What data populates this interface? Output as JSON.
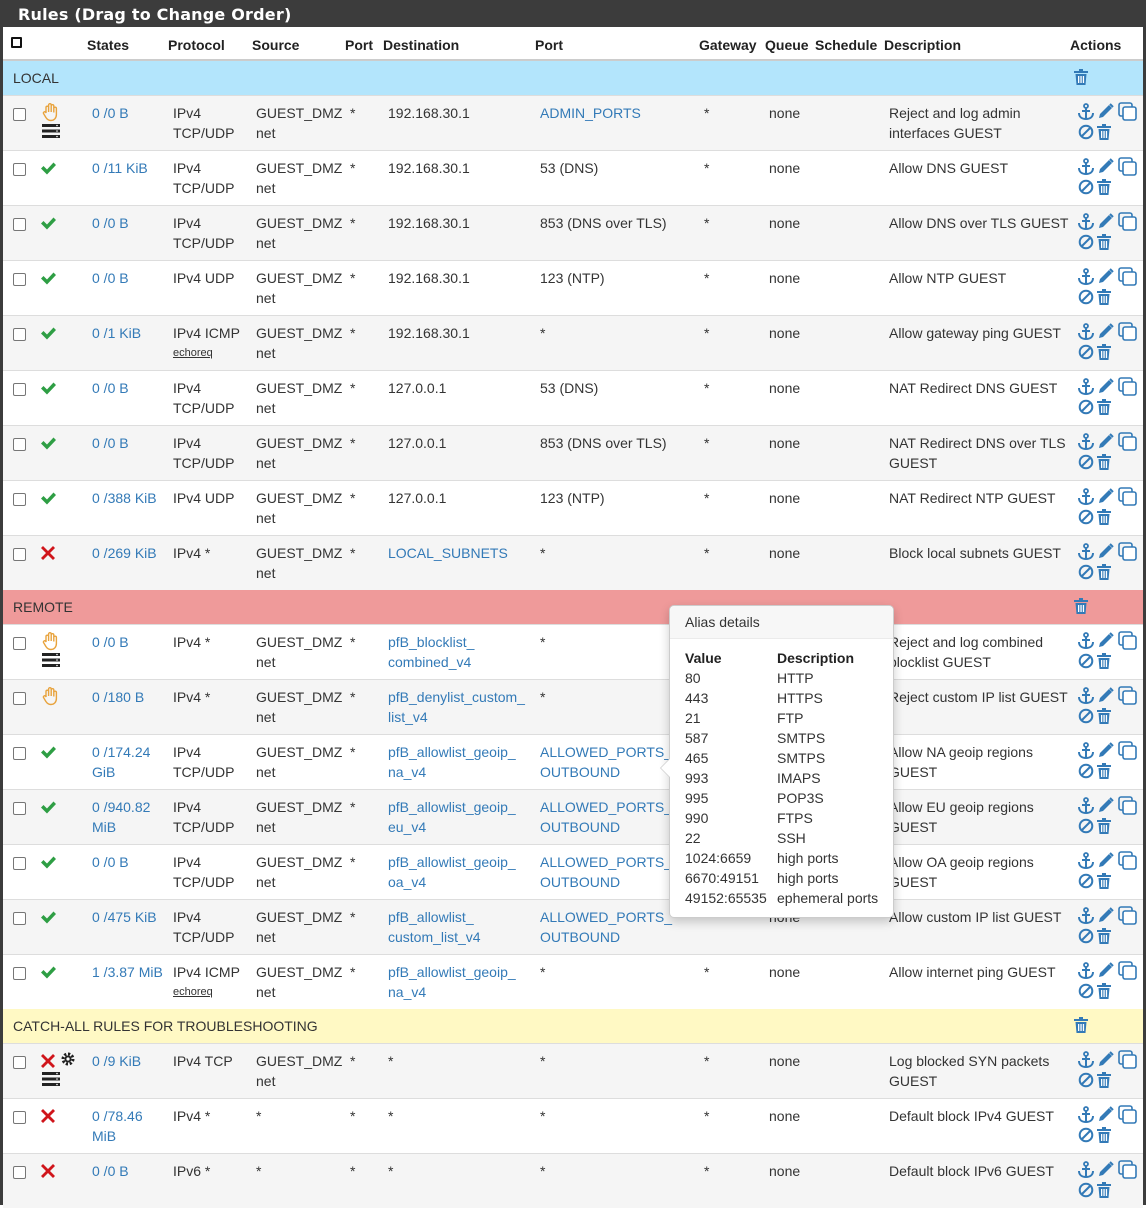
{
  "panel_title": "Rules (Drag to Change Order)",
  "columns": {
    "states": "States",
    "protocol": "Protocol",
    "source": "Source",
    "port": "Port",
    "destination": "Destination",
    "dport": "Port",
    "gateway": "Gateway",
    "queue": "Queue",
    "schedule": "Schedule",
    "description": "Description",
    "actions": "Actions"
  },
  "separators": [
    {
      "label": "LOCAL",
      "color": "#b3e5fc"
    },
    {
      "label": "REMOTE",
      "color": "#ef9a9a"
    },
    {
      "label": "CATCH-ALL RULES FOR TROUBLESHOOTING",
      "color": "#fff9c4"
    }
  ],
  "rules": [
    {
      "status": "reject",
      "log": true,
      "states": "0 /0 B",
      "proto": "IPv4 TCP/UDP",
      "proto2": "",
      "src": "GUEST_DMZ net",
      "sport": "*",
      "dst": "192.168.30.1",
      "dst_link": false,
      "dport": "ADMIN_PORTS",
      "dport_link": true,
      "gw": "*",
      "queue": "none",
      "desc": "Reject and log admin interfaces GUEST"
    },
    {
      "status": "pass",
      "log": false,
      "states": "0 /11 KiB",
      "proto": "IPv4 TCP/UDP",
      "proto2": "",
      "src": "GUEST_DMZ net",
      "sport": "*",
      "dst": "192.168.30.1",
      "dst_link": false,
      "dport": "53 (DNS)",
      "dport_link": false,
      "gw": "*",
      "queue": "none",
      "desc": "Allow DNS GUEST"
    },
    {
      "status": "pass",
      "log": false,
      "states": "0 /0 B",
      "proto": "IPv4 TCP/UDP",
      "proto2": "",
      "src": "GUEST_DMZ net",
      "sport": "*",
      "dst": "192.168.30.1",
      "dst_link": false,
      "dport": "853 (DNS over TLS)",
      "dport_link": false,
      "gw": "*",
      "queue": "none",
      "desc": "Allow DNS over TLS GUEST"
    },
    {
      "status": "pass",
      "log": false,
      "states": "0 /0 B",
      "proto": "IPv4 UDP",
      "proto2": "",
      "src": "GUEST_DMZ net",
      "sport": "*",
      "dst": "192.168.30.1",
      "dst_link": false,
      "dport": "123 (NTP)",
      "dport_link": false,
      "gw": "*",
      "queue": "none",
      "desc": "Allow NTP GUEST"
    },
    {
      "status": "pass",
      "log": false,
      "states": "0 /1 KiB",
      "proto": "IPv4 ICMP",
      "proto2": "echoreq",
      "src": "GUEST_DMZ net",
      "sport": "*",
      "dst": "192.168.30.1",
      "dst_link": false,
      "dport": "*",
      "dport_link": false,
      "gw": "*",
      "queue": "none",
      "desc": "Allow gateway ping GUEST"
    },
    {
      "status": "pass",
      "log": false,
      "states": "0 /0 B",
      "proto": "IPv4 TCP/UDP",
      "proto2": "",
      "src": "GUEST_DMZ net",
      "sport": "*",
      "dst": "127.0.0.1",
      "dst_link": false,
      "dport": "53 (DNS)",
      "dport_link": false,
      "gw": "*",
      "queue": "none",
      "desc": "NAT Redirect DNS GUEST"
    },
    {
      "status": "pass",
      "log": false,
      "states": "0 /0 B",
      "proto": "IPv4 TCP/UDP",
      "proto2": "",
      "src": "GUEST_DMZ net",
      "sport": "*",
      "dst": "127.0.0.1",
      "dst_link": false,
      "dport": "853 (DNS over TLS)",
      "dport_link": false,
      "gw": "*",
      "queue": "none",
      "desc": "NAT Redirect DNS over TLS GUEST"
    },
    {
      "status": "pass",
      "log": false,
      "states": "0 /388 KiB",
      "proto": "IPv4 UDP",
      "proto2": "",
      "src": "GUEST_DMZ net",
      "sport": "*",
      "dst": "127.0.0.1",
      "dst_link": false,
      "dport": "123 (NTP)",
      "dport_link": false,
      "gw": "*",
      "queue": "none",
      "desc": "NAT Redirect NTP GUEST"
    },
    {
      "status": "block",
      "log": false,
      "states": "0 /269 KiB",
      "proto": "IPv4 *",
      "proto2": "",
      "src": "GUEST_DMZ net",
      "sport": "*",
      "dst": "LOCAL_SUBNETS",
      "dst_link": true,
      "dport": "*",
      "dport_link": false,
      "gw": "*",
      "queue": "none",
      "desc": "Block local subnets GUEST"
    },
    {
      "status": "reject",
      "log": true,
      "states": "0 /0 B",
      "proto": "IPv4 *",
      "proto2": "",
      "src": "GUEST_DMZ net",
      "sport": "*",
      "dst": "pfB_blocklist_ combined_v4",
      "dst_link": true,
      "dport": "*",
      "dport_link": false,
      "gw": "",
      "queue": "",
      "desc": "Reject and log combined blocklist GUEST"
    },
    {
      "status": "reject",
      "log": false,
      "states": "0 /180 B",
      "proto": "IPv4 *",
      "proto2": "",
      "src": "GUEST_DMZ net",
      "sport": "*",
      "dst": "pfB_denylist_custom_ list_v4",
      "dst_link": true,
      "dport": "*",
      "dport_link": false,
      "gw": "",
      "queue": "",
      "desc": "Reject custom IP list GUEST"
    },
    {
      "status": "pass",
      "log": false,
      "states": "0 /174.24 GiB",
      "proto": "IPv4 TCP/UDP",
      "proto2": "",
      "src": "GUEST_DMZ net",
      "sport": "*",
      "dst": "pfB_allowlist_geoip_ na_v4",
      "dst_link": true,
      "dport": "ALLOWED_PORTS_ OUTBOUND",
      "dport_link": true,
      "gw": "",
      "queue": "",
      "desc": "Allow NA geoip regions GUEST"
    },
    {
      "status": "pass",
      "log": false,
      "states": "0 /940.82 MiB",
      "proto": "IPv4 TCP/UDP",
      "proto2": "",
      "src": "GUEST_DMZ net",
      "sport": "*",
      "dst": "pfB_allowlist_geoip_ eu_v4",
      "dst_link": true,
      "dport": "ALLOWED_PORTS_ OUTBOUND",
      "dport_link": true,
      "gw": "",
      "queue": "",
      "desc": "Allow EU geoip regions GUEST"
    },
    {
      "status": "pass",
      "log": false,
      "states": "0 /0 B",
      "proto": "IPv4 TCP/UDP",
      "proto2": "",
      "src": "GUEST_DMZ net",
      "sport": "*",
      "dst": "pfB_allowlist_geoip_ oa_v4",
      "dst_link": true,
      "dport": "ALLOWED_PORTS_ OUTBOUND",
      "dport_link": true,
      "gw": "",
      "queue": "",
      "desc": "Allow OA geoip regions GUEST"
    },
    {
      "status": "pass",
      "log": false,
      "states": "0 /475 KiB",
      "proto": "IPv4 TCP/UDP",
      "proto2": "",
      "src": "GUEST_DMZ net",
      "sport": "*",
      "dst": "pfB_allowlist_ custom_list_v4",
      "dst_link": true,
      "dport": "ALLOWED_PORTS_ OUTBOUND",
      "dport_link": true,
      "gw": "",
      "queue": "none",
      "desc": "Allow custom IP list GUEST"
    },
    {
      "status": "pass",
      "log": false,
      "states": "1 /3.87 MiB",
      "proto": "IPv4 ICMP",
      "proto2": "echoreq",
      "src": "GUEST_DMZ net",
      "sport": "*",
      "dst": "pfB_allowlist_geoip_ na_v4",
      "dst_link": true,
      "dport": "*",
      "dport_link": false,
      "gw": "*",
      "queue": "none",
      "desc": "Allow internet ping GUEST"
    },
    {
      "status": "block",
      "log": true,
      "adv": true,
      "states": "0 /9 KiB",
      "proto": "IPv4 TCP",
      "proto2": "",
      "src": "GUEST_DMZ net",
      "sport": "*",
      "dst": "*",
      "dst_link": false,
      "dport": "*",
      "dport_link": false,
      "gw": "*",
      "queue": "none",
      "desc": "Log blocked SYN packets GUEST"
    },
    {
      "status": "block",
      "log": false,
      "states": "0 /78.46 MiB",
      "proto": "IPv4 *",
      "proto2": "",
      "src": "*",
      "sport": "*",
      "dst": "*",
      "dst_link": false,
      "dport": "*",
      "dport_link": false,
      "gw": "*",
      "queue": "none",
      "desc": "Default block IPv4 GUEST"
    },
    {
      "status": "block",
      "log": false,
      "states": "0 /0 B",
      "proto": "IPv6 *",
      "proto2": "",
      "src": "*",
      "sport": "*",
      "dst": "*",
      "dst_link": false,
      "dport": "*",
      "dport_link": false,
      "gw": "*",
      "queue": "none",
      "desc": "Default block IPv6 GUEST"
    }
  ],
  "popover": {
    "title": "Alias details",
    "col_value": "Value",
    "col_desc": "Description",
    "items": [
      {
        "v": "80",
        "d": "HTTP"
      },
      {
        "v": "443",
        "d": "HTTPS"
      },
      {
        "v": "21",
        "d": "FTP"
      },
      {
        "v": "587",
        "d": "SMTPS"
      },
      {
        "v": "465",
        "d": "SMTPS"
      },
      {
        "v": "993",
        "d": "IMAPS"
      },
      {
        "v": "995",
        "d": "POP3S"
      },
      {
        "v": "990",
        "d": "FTPS"
      },
      {
        "v": "22",
        "d": "SSH"
      },
      {
        "v": "1024:6659",
        "d": "high ports"
      },
      {
        "v": "6670:49151",
        "d": "high ports"
      },
      {
        "v": "49152:65535",
        "d": "ephemeral ports"
      }
    ]
  },
  "colors": {
    "link": "#337ab7",
    "pass": "#2e9e44",
    "block": "#d0151b",
    "reject": "#e8a33d",
    "accent": "#337ab7"
  }
}
